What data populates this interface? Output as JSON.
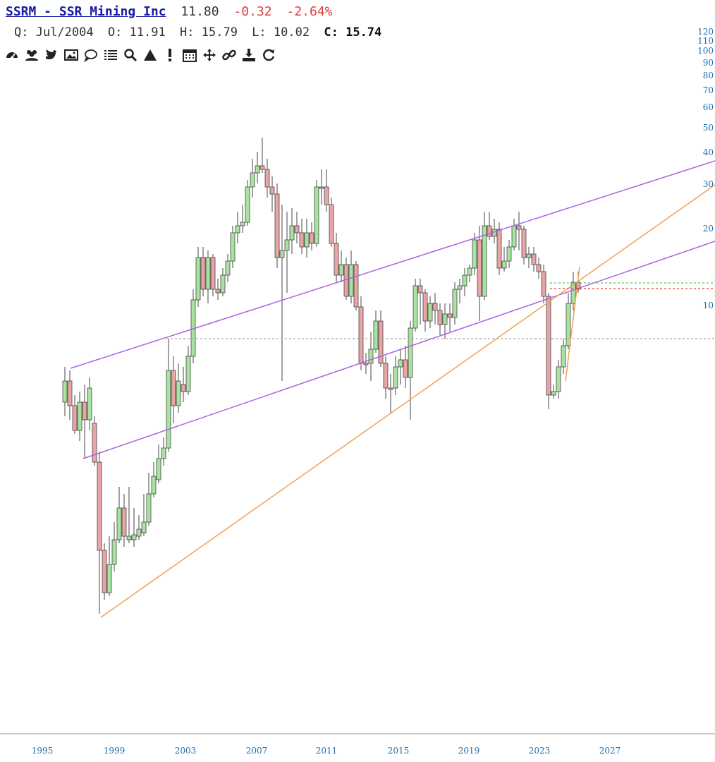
{
  "header": {
    "ticker_title": "SSRM - SSR Mining Inc",
    "last_price": "11.80",
    "change": "-0.32",
    "change_pct": "-2.64%",
    "colors": {
      "title": "#1a1aa8",
      "negative": "#e03c3c"
    }
  },
  "ohlc": {
    "period": "Q: Jul/2004",
    "open_label": "O:",
    "open": "11.91",
    "high_label": "H:",
    "high": "15.79",
    "low_label": "L:",
    "low": "10.02",
    "close_label": "C:",
    "close": "15.74"
  },
  "toolbar": {
    "icons": [
      "dashboard-icon",
      "users-icon",
      "twitter-icon",
      "image-icon",
      "comment-icon",
      "list-icon",
      "search-icon",
      "triangle-up-icon",
      "exclamation-icon",
      "calendar-icon",
      "move-icon",
      "link-icon",
      "download-icon",
      "refresh-icon"
    ]
  },
  "chart_data": {
    "type": "candlestick",
    "scale": "log",
    "y_ticks": [
      "120",
      "110",
      "100",
      "90",
      "80",
      "70",
      "60",
      "50",
      "40",
      "30",
      "20",
      "10"
    ],
    "x_ticks": [
      "1995",
      "1999",
      "2003",
      "2007",
      "2011",
      "2015",
      "2019",
      "2023",
      "2027"
    ],
    "colors": {
      "up": "#a8e3a0",
      "down": "#e9a5a5",
      "channel": "#b060e0",
      "trend": "#f0a050",
      "green_level": "#4cc94c",
      "red_level": "#e04040",
      "gray_level": "#aaaaaa"
    }
  }
}
